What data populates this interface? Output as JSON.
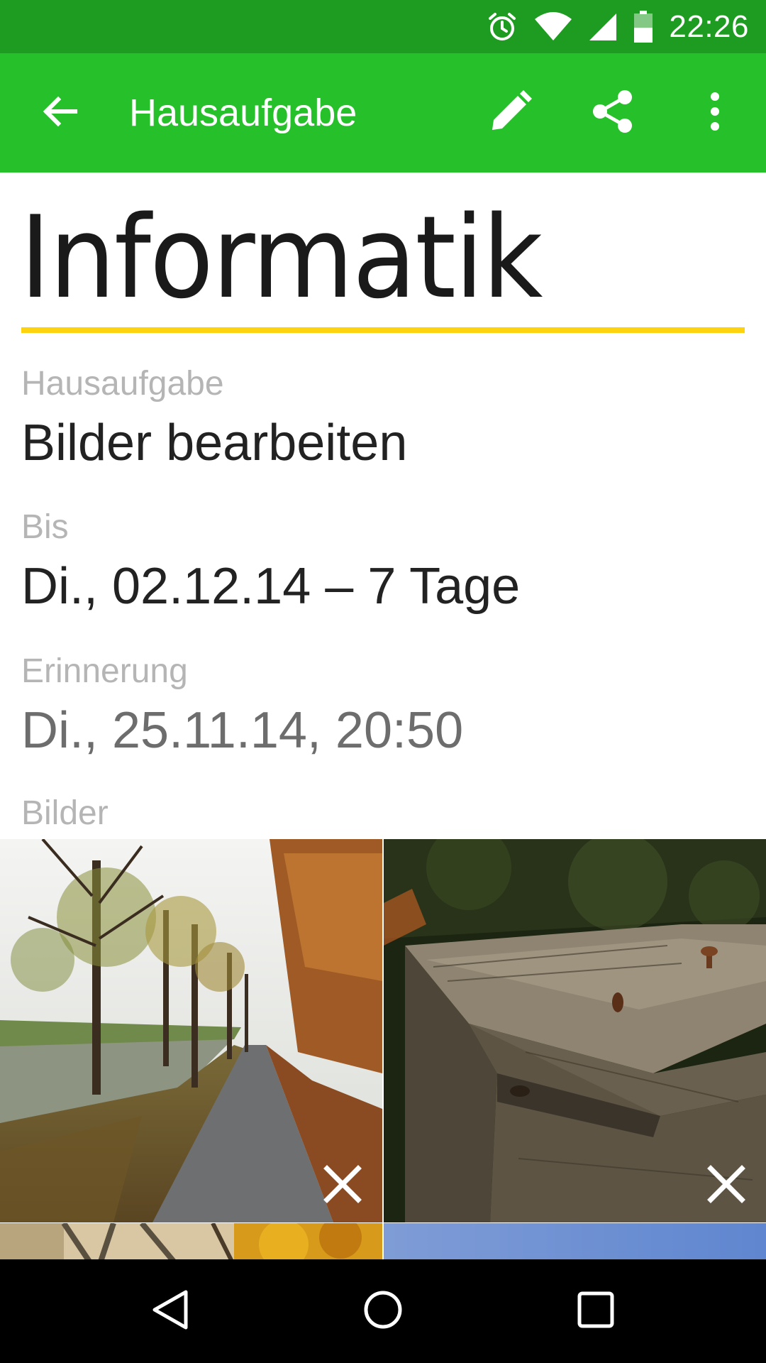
{
  "status_bar": {
    "time": "22:26",
    "icons": [
      "alarm-icon",
      "wifi-icon",
      "signal-icon",
      "battery-icon"
    ]
  },
  "app_bar": {
    "title": "Hausaufgabe",
    "actions": [
      "back-arrow-icon",
      "edit-pencil-icon",
      "share-icon",
      "more-vert-icon"
    ]
  },
  "detail": {
    "subject": "Informatik",
    "homework_label": "Hausaufgabe",
    "homework_value": "Bilder bearbeiten",
    "due_label": "Bis",
    "due_value": "Di., 02.12.14 – 7 Tage",
    "reminder_label": "Erinnerung",
    "reminder_value": "Di., 25.11.14, 20:50",
    "images_label": "Bilder"
  },
  "images": [
    {
      "subject": "autumn tree-lined path by canal",
      "removable": true
    },
    {
      "subject": "weathered wooden planks with rusty nail",
      "removable": true
    },
    {
      "subject": "autumn branches",
      "removable": false
    },
    {
      "subject": "blue sky",
      "removable": false
    }
  ],
  "colors": {
    "status_bar": "#1e9b21",
    "app_bar": "#26c02a",
    "accent_underline": "#fdd20e",
    "label_gray": "#b5b5b5"
  },
  "nav_bar": {
    "buttons": [
      "nav-back-icon",
      "nav-home-icon",
      "nav-recents-icon"
    ]
  }
}
